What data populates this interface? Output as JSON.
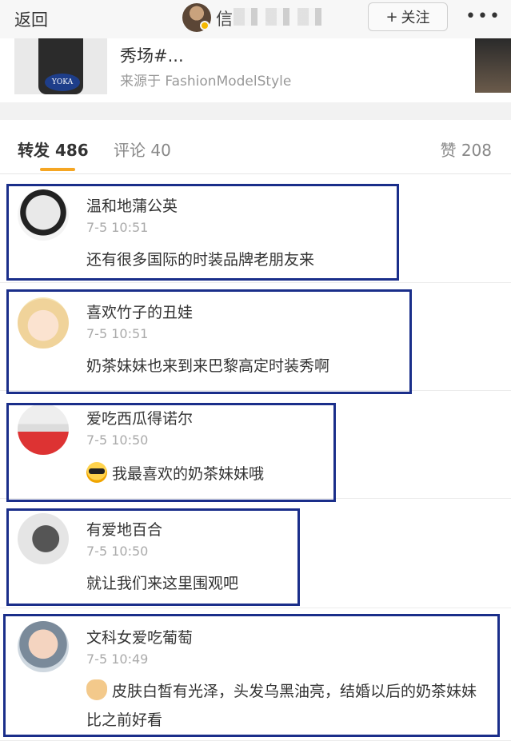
{
  "header": {
    "back_label": "返回",
    "title_visible": "信",
    "follow_label": "关注",
    "follow_icon": "plus-icon",
    "more_icon": "ellipsis-icon"
  },
  "source_card": {
    "title": "秀场#...",
    "source": "来源于 FashionModelStyle",
    "thumb_logo_text": "YOKA"
  },
  "tabs": {
    "repost": "转发 486",
    "comment": "评论 40",
    "like": "赞 208"
  },
  "reposts": [
    {
      "name": "温和地蒲公英",
      "time": "7-5 10:51",
      "text": "还有很多国际的时装品牌老朋友来",
      "emoji": null
    },
    {
      "name": "喜欢竹子的丑娃",
      "time": "7-5 10:51",
      "text": "奶茶妹妹也来到来巴黎高定时装秀啊",
      "emoji": null
    },
    {
      "name": "爱吃西瓜得诺尔",
      "time": "7-5 10:50",
      "text": "我最喜欢的奶茶妹妹哦",
      "emoji": "sunglasses-emoji-icon"
    },
    {
      "name": "有爱地百合",
      "time": "7-5 10:50",
      "text": "就让我们来这里围观吧",
      "emoji": null
    },
    {
      "name": "文科女爱吃葡萄",
      "time": "7-5 10:49",
      "text": "皮肤白皙有光泽，头发乌黑油亮，结婚以后的奶茶妹妹比之前好看",
      "emoji": "victory-hand-emoji-icon"
    }
  ],
  "colors": {
    "highlight_border": "#1a2e8a",
    "tab_underline": "#f5a623",
    "header_bg": "#f7f7f7"
  }
}
